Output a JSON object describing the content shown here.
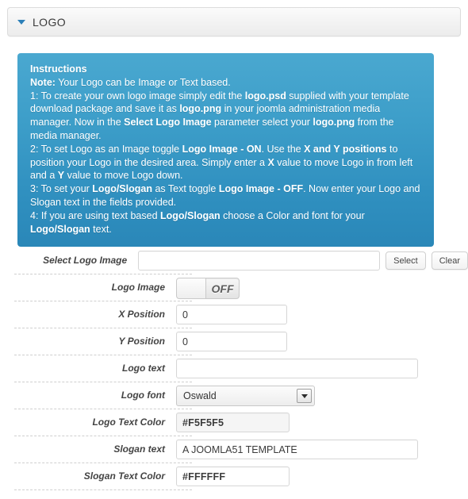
{
  "panel": {
    "title": "LOGO",
    "caret_icon": "caret-down-icon"
  },
  "instructions": {
    "heading": "Instructions",
    "note_label": "Note:",
    "note_text": " Your Logo can be Image or Text based.",
    "lines": [
      {
        "segments": [
          {
            "t": "1: To create your own logo image simply edit the ",
            "b": false
          },
          {
            "t": "logo.psd",
            "b": true
          },
          {
            "t": " supplied with your template download package and save it as ",
            "b": false
          },
          {
            "t": "logo.png",
            "b": true
          },
          {
            "t": " in your joomla administration media manager. Now in the ",
            "b": false
          },
          {
            "t": "Select Logo Image",
            "b": true
          },
          {
            "t": " parameter select your ",
            "b": false
          },
          {
            "t": "logo.png",
            "b": true
          },
          {
            "t": " from the media manager.",
            "b": false
          }
        ]
      },
      {
        "segments": [
          {
            "t": "2: To set Logo as an Image toggle ",
            "b": false
          },
          {
            "t": "Logo Image - ON",
            "b": true
          },
          {
            "t": ". Use the ",
            "b": false
          },
          {
            "t": "X and Y positions",
            "b": true
          },
          {
            "t": " to position your Logo in the desired area. Simply enter a ",
            "b": false
          },
          {
            "t": "X",
            "b": true
          },
          {
            "t": " value to move Logo in from left and a ",
            "b": false
          },
          {
            "t": "Y",
            "b": true
          },
          {
            "t": " value to move Logo down.",
            "b": false
          }
        ]
      },
      {
        "segments": [
          {
            "t": "3: To set your ",
            "b": false
          },
          {
            "t": "Logo/Slogan",
            "b": true
          },
          {
            "t": " as Text toggle ",
            "b": false
          },
          {
            "t": "Logo Image - OFF",
            "b": true
          },
          {
            "t": ". Now enter your Logo and Slogan text in the fields provided.",
            "b": false
          }
        ]
      },
      {
        "segments": [
          {
            "t": "4: If you are using text based ",
            "b": false
          },
          {
            "t": "Logo/Slogan",
            "b": true
          },
          {
            "t": " choose a Color and font for your ",
            "b": false
          },
          {
            "t": "Logo/Slogan",
            "b": true
          },
          {
            "t": " text.",
            "b": false
          }
        ]
      }
    ]
  },
  "form": {
    "select_logo_image": {
      "label": "Select Logo Image",
      "value": "",
      "placeholder": "",
      "select_button": "Select",
      "clear_button": "Clear"
    },
    "logo_image": {
      "label": "Logo Image",
      "state": "OFF"
    },
    "x_position": {
      "label": "X Position",
      "value": "0"
    },
    "y_position": {
      "label": "Y Position",
      "value": "0"
    },
    "logo_text": {
      "label": "Logo text",
      "value": "",
      "placeholder": ""
    },
    "logo_font": {
      "label": "Logo font",
      "value": "Oswald",
      "arrow_icon": "chevron-down-icon"
    },
    "logo_text_color": {
      "label": "Logo Text Color",
      "value": "#F5F5F5"
    },
    "slogan_text": {
      "label": "Slogan text",
      "value": "A JOOMLA51 TEMPLATE"
    },
    "slogan_text_color": {
      "label": "Slogan Text Color",
      "value": "#FFFFFF"
    }
  },
  "colors": {
    "instructions_bg_top": "#4aa8d0",
    "instructions_bg_bottom": "#2a87b8",
    "caret": "#2c7fb8",
    "logo_text_color_swatch": "#F5F5F5",
    "slogan_text_color_swatch": "#FFFFFF"
  }
}
